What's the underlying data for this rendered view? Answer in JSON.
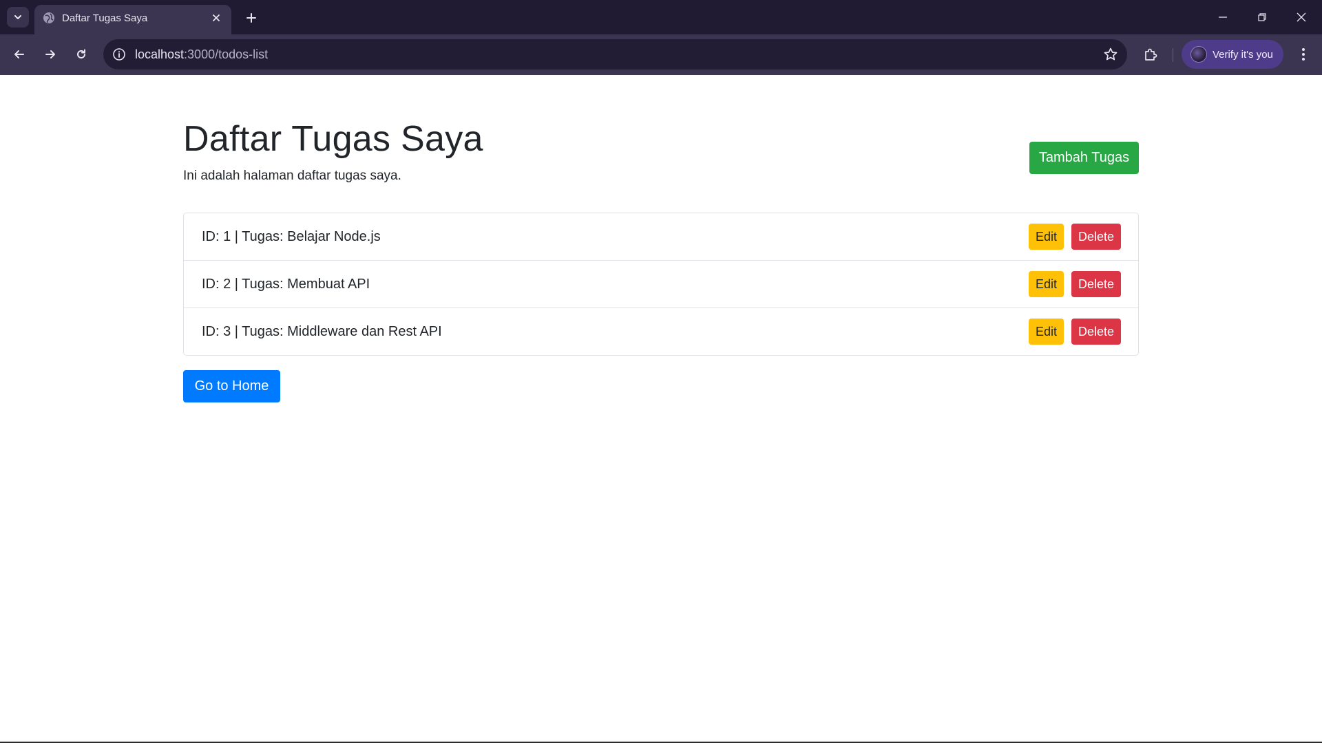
{
  "browser": {
    "tab": {
      "title": "Daftar Tugas Saya",
      "favicon": "globe-icon"
    },
    "omnibox": {
      "host": "localhost",
      "path": ":3000/todos-list"
    },
    "profile": {
      "label": "Verify it's you"
    },
    "icons": {
      "tab_search": "chevron-down-icon",
      "new_tab": "plus-icon",
      "back": "arrow-left-icon",
      "forward": "arrow-right-icon",
      "reload": "reload-icon",
      "site_info": "info-icon",
      "bookmark": "star-icon",
      "extensions": "puzzle-icon",
      "menu": "kebab-menu-icon"
    },
    "colors": {
      "tabstrip": "#211a33",
      "toolbar": "#3b3551",
      "profile_chip": "#4e3c8a"
    }
  },
  "page": {
    "title": "Daftar Tugas Saya",
    "subtitle": "Ini adalah halaman daftar tugas saya.",
    "add_button": "Tambah Tugas",
    "home_button": "Go to Home",
    "todos": [
      {
        "text": "ID: 1 | Tugas: Belajar Node.js",
        "edit": "Edit",
        "delete": "Delete"
      },
      {
        "text": "ID: 2 | Tugas: Membuat API",
        "edit": "Edit",
        "delete": "Delete"
      },
      {
        "text": "ID: 3 | Tugas: Middleware dan Rest API",
        "edit": "Edit",
        "delete": "Delete"
      }
    ],
    "colors": {
      "success": "#28a745",
      "warning": "#ffc107",
      "danger": "#dc3545",
      "primary": "#007bff"
    }
  }
}
